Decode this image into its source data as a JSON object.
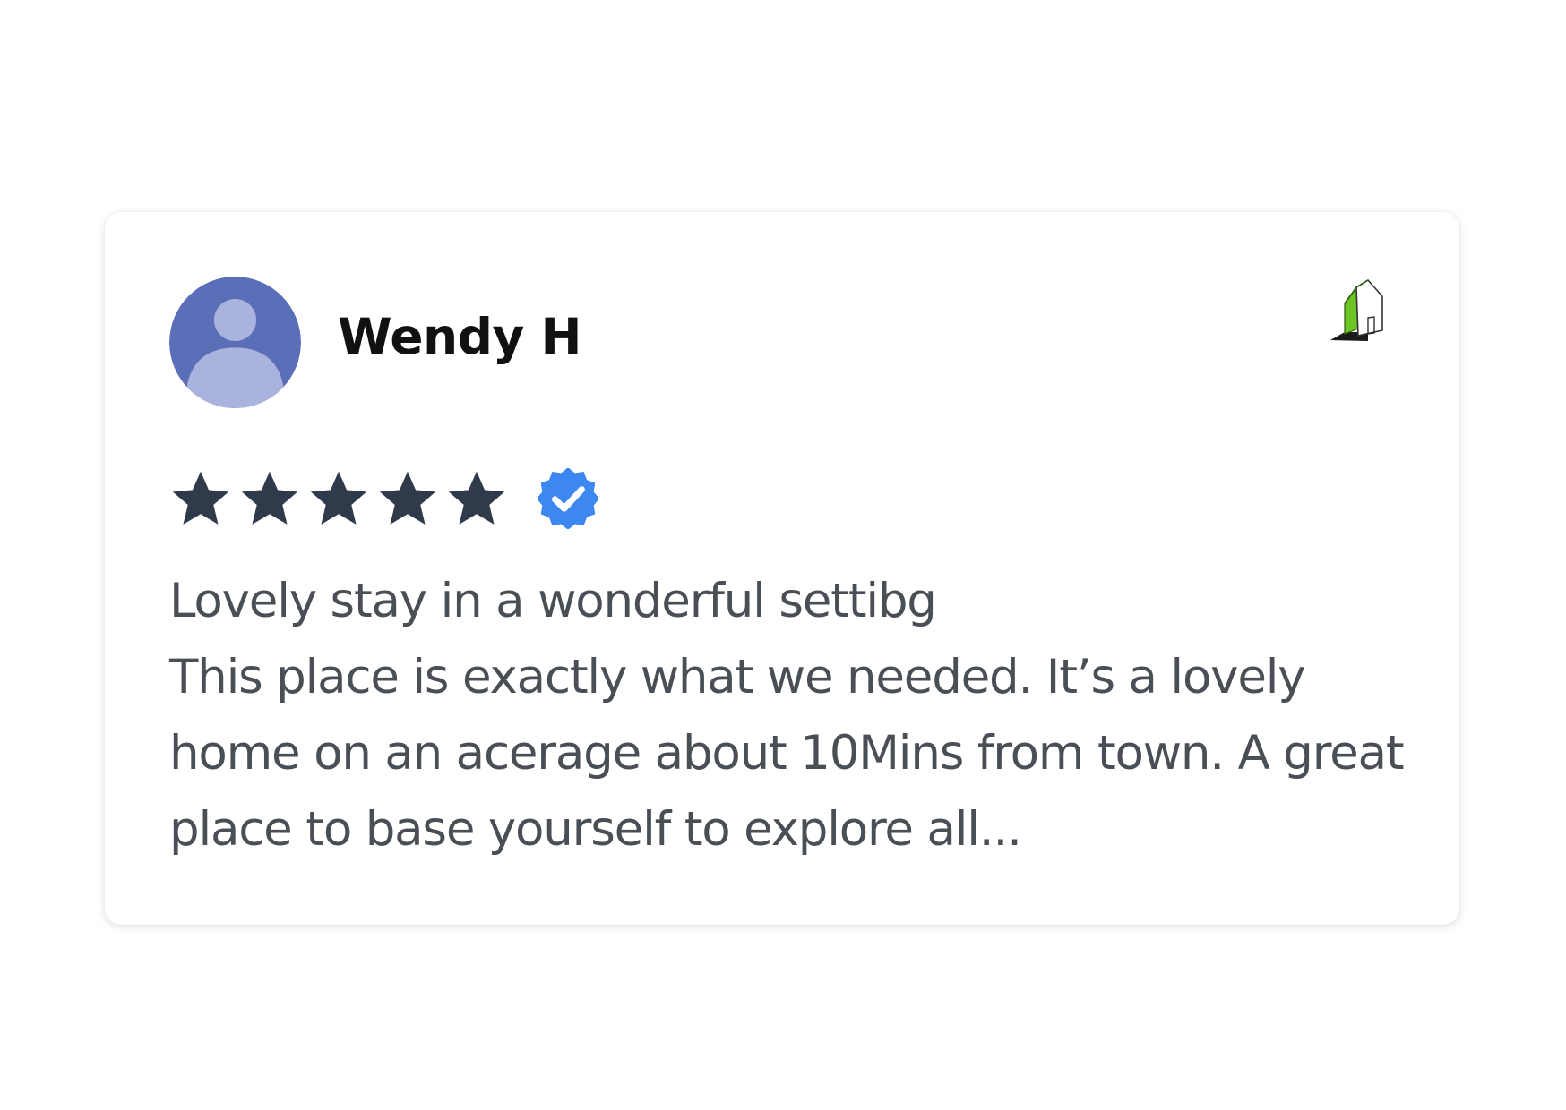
{
  "review": {
    "reviewer_name": "Wendy H",
    "rating": 5,
    "rating_max": 5,
    "title": "Lovely stay in a wonderful settibg",
    "body": "This place is exactly what we needed. It’s a lovely home on an acerage about 10Mins from town. A great place to base yourself to explore all...",
    "avatar_icon": "default-user-avatar-icon",
    "source_icon": "house-logo-icon",
    "verified_icon": "verified-badge-icon"
  },
  "colors": {
    "star": "#2f3b4a",
    "verified": "#3d87f0",
    "avatar_bg": "#5b6fb8",
    "avatar_fg": "#a9b3dd",
    "house_green": "#6cc427",
    "text": "#4a4f55",
    "name": "#111111"
  }
}
